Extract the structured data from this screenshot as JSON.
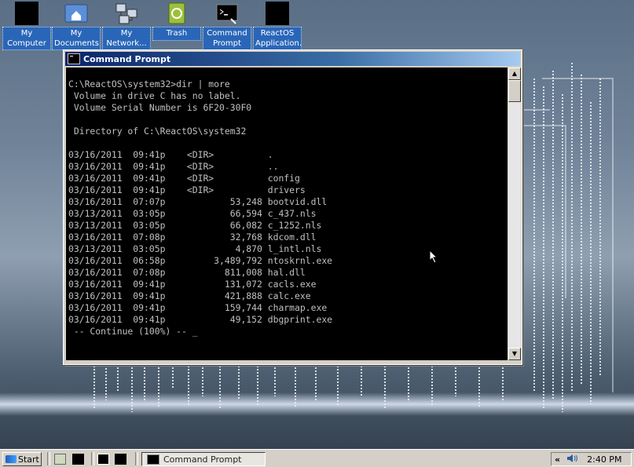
{
  "desktop": {
    "icons": [
      {
        "label": "My\nComputer",
        "icon": "computer-icon"
      },
      {
        "label": "My\nDocuments",
        "icon": "documents-folder-icon"
      },
      {
        "label": "My\nNetwork...",
        "icon": "network-icon"
      },
      {
        "label": "Trash",
        "icon": "trash-icon"
      },
      {
        "label": "Command\nPrompt",
        "icon": "command-prompt-icon"
      },
      {
        "label": "ReactOS\nApplication...",
        "icon": "application-icon"
      }
    ]
  },
  "window": {
    "title": "Command Prompt",
    "console_lines": [
      "C:\\ReactOS\\system32>dir | more",
      " Volume in drive C has no label.",
      " Volume Serial Number is 6F20-30F0",
      "",
      " Directory of C:\\ReactOS\\system32",
      "",
      "03/16/2011  09:41p    <DIR>          .",
      "03/16/2011  09:41p    <DIR>          ..",
      "03/16/2011  09:41p    <DIR>          config",
      "03/16/2011  09:41p    <DIR>          drivers",
      "03/16/2011  07:07p            53,248 bootvid.dll",
      "03/13/2011  03:05p            66,594 c_437.nls",
      "03/13/2011  03:05p            66,082 c_1252.nls",
      "03/16/2011  07:08p            32,768 kdcom.dll",
      "03/13/2011  03:05p             4,870 l_intl.nls",
      "03/16/2011  06:58p         3,489,792 ntoskrnl.exe",
      "03/16/2011  07:08p           811,008 hal.dll",
      "03/16/2011  09:41p           131,072 cacls.exe",
      "03/16/2011  09:41p           421,888 calc.exe",
      "03/16/2011  09:41p           159,744 charmap.exe",
      "03/16/2011  09:41p            49,152 dbgprint.exe",
      " -- Continue (100%) -- _"
    ]
  },
  "taskbar": {
    "start_label": "Start",
    "task_label": "Command Prompt",
    "tray_chevron": "«",
    "clock": "2:40 PM"
  },
  "colors": {
    "console_bg": "#000000",
    "console_text": "#c0c0c0",
    "titlebar_start": "#0a246a",
    "titlebar_end": "#a6caf0",
    "icon_label_bg": "#2a66b8"
  }
}
